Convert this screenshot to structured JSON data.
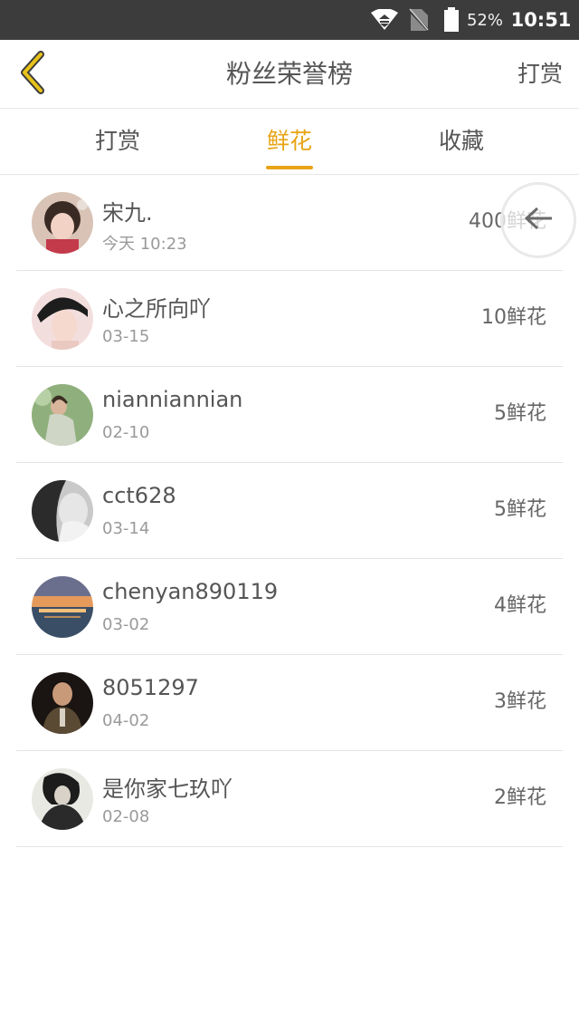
{
  "status_bar": {
    "battery_percent": "52%",
    "time": "10:51",
    "icons": [
      "wifi-icon",
      "no-sim-icon",
      "battery-icon"
    ]
  },
  "header": {
    "back_icon": "chevron-left-icon",
    "title": "粉丝荣誉榜",
    "action_label": "打赏"
  },
  "tabs": [
    {
      "label": "打赏",
      "active": false
    },
    {
      "label": "鲜花",
      "active": true
    },
    {
      "label": "收藏",
      "active": false
    }
  ],
  "list": [
    {
      "name": "宋九.",
      "date": "今天 10:23",
      "amount": "400鲜花"
    },
    {
      "name": "心之所向吖",
      "date": "03-15",
      "amount": "10鲜花"
    },
    {
      "name": "nianniannian",
      "date": "02-10",
      "amount": "5鲜花"
    },
    {
      "name": "cct628",
      "date": "03-14",
      "amount": "5鲜花"
    },
    {
      "name": "chenyan890119",
      "date": "03-02",
      "amount": "4鲜花"
    },
    {
      "name": "8051297",
      "date": "04-02",
      "amount": "3鲜花"
    },
    {
      "name": "是你家七玖吖",
      "date": "02-08",
      "amount": "2鲜花"
    }
  ],
  "floating_button": {
    "icon": "arrow-left-icon"
  },
  "colors": {
    "accent": "#e8a416",
    "status_bar": "#3c3c3c",
    "divider": "#e4e4e4"
  }
}
